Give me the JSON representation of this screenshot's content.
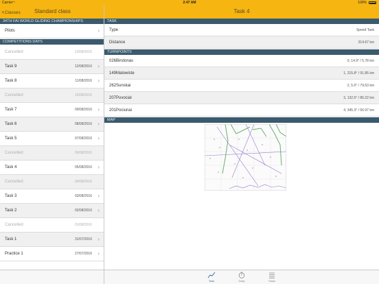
{
  "status_bar": {
    "carrier": "Carrier",
    "time": "2:47 AM",
    "battery": "100%"
  },
  "left_nav": {
    "back_label": "Classes",
    "title": "Standard class"
  },
  "right_nav": {
    "title": "Task 4"
  },
  "competition": {
    "header": "34TH FAI WORLD GLIDING CHAMPIONSHIPS",
    "pilots_label": "Pilots"
  },
  "days_header": "COMPETITIONS DAYS",
  "days": [
    {
      "name": "Cancelled",
      "date": "13/08/2016"
    },
    {
      "name": "Task 9",
      "date": "12/08/2016"
    },
    {
      "name": "Task 8",
      "date": "11/08/2016"
    },
    {
      "name": "Cancelled",
      "date": "10/08/2016"
    },
    {
      "name": "Task 7",
      "date": "09/08/2016"
    },
    {
      "name": "Task 6",
      "date": "08/08/2016"
    },
    {
      "name": "Task 5",
      "date": "07/08/2016"
    },
    {
      "name": "Cancelled",
      "date": "06/08/2016"
    },
    {
      "name": "Task 4",
      "date": "05/08/2016"
    },
    {
      "name": "Cancelled",
      "date": "04/08/2016"
    },
    {
      "name": "Task 3",
      "date": "03/08/2016"
    },
    {
      "name": "Task 2",
      "date": "02/08/2016"
    },
    {
      "name": "Cancelled",
      "date": "01/08/2016"
    },
    {
      "name": "Task 1",
      "date": "31/07/2016"
    },
    {
      "name": "Practice 1",
      "date": "27/07/2016"
    }
  ],
  "task": {
    "header": "TASK",
    "type_label": "Type",
    "type_value": "Speed Task",
    "distance_label": "Distance",
    "distance_value": "314.67 km"
  },
  "turnpoints_header": "TURNPOINTS",
  "turnpoints": [
    {
      "name": "026Birstonas",
      "value": "0, 14.9° / 5.78 km"
    },
    {
      "name": "149Malowiste",
      "value": "1, 215.8° / 91.85 km"
    },
    {
      "name": "262Sunskai",
      "value": "2, 5.0° / 79.63 km"
    },
    {
      "name": "207Puvocial",
      "value": "3, 132.5° / 86.22 km"
    },
    {
      "name": "201Pociunai",
      "value": "4, 345.3° / 56.97 km"
    }
  ],
  "map_header": "MAP",
  "tabs": [
    {
      "label": "Task",
      "icon": "chart-line-icon",
      "active": true
    },
    {
      "label": "Daily",
      "icon": "stopwatch-icon",
      "active": false
    },
    {
      "label": "Totals",
      "icon": "list-icon",
      "active": false
    }
  ],
  "colors": {
    "accent": "#f6b511",
    "section": "#3b5a6e",
    "tab_active": "#3a6fa8"
  }
}
